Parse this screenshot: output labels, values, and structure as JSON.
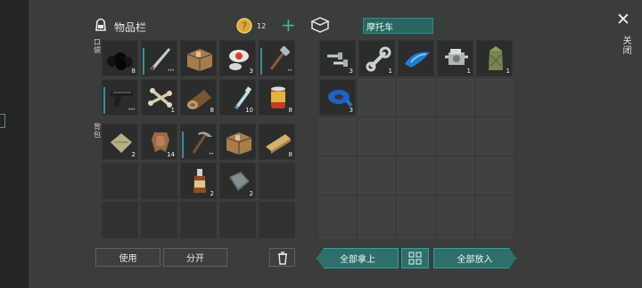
{
  "window": {
    "inventory_title": "物品栏",
    "coins": "12",
    "plus": "+",
    "vehicle_title": "摩托车",
    "close_label": "关闭",
    "pocket_label": "口袋",
    "backpack_label": "背包"
  },
  "inventory": {
    "row1": [
      {
        "label": "coal",
        "count": "8"
      },
      {
        "label": "machete",
        "count": ""
      },
      {
        "label": "box",
        "count": ""
      },
      {
        "label": "bandage",
        "count": "3"
      },
      {
        "label": "hammer",
        "count": ""
      }
    ],
    "row2": [
      {
        "label": "pistol",
        "count": ""
      },
      {
        "label": "bones",
        "count": "1"
      },
      {
        "label": "log",
        "count": "8"
      },
      {
        "label": "water-bottle",
        "count": "10"
      },
      {
        "label": "canned-food",
        "count": "8"
      }
    ],
    "row3": [
      {
        "label": "sack",
        "count": "2"
      },
      {
        "label": "leather",
        "count": "14"
      },
      {
        "label": "pickaxe",
        "count": ""
      },
      {
        "label": "box",
        "count": ""
      },
      {
        "label": "wood-plank",
        "count": "8"
      }
    ],
    "row4": [
      {
        "label": "empty",
        "count": ""
      },
      {
        "label": "empty",
        "count": ""
      },
      {
        "label": "whiskey",
        "count": "2"
      },
      {
        "label": "metal-plate",
        "count": "2"
      },
      {
        "label": "empty",
        "count": ""
      }
    ]
  },
  "vehicle": {
    "row1": [
      {
        "label": "bolts",
        "count": "3"
      },
      {
        "label": "wrench",
        "count": "1"
      },
      {
        "label": "gas-tank",
        "count": ""
      },
      {
        "label": "engine",
        "count": "1"
      },
      {
        "label": "fuel-can",
        "count": "1"
      }
    ],
    "row2": [
      {
        "label": "tape",
        "count": "3"
      }
    ]
  },
  "buttons": {
    "use": "使用",
    "split": "分开",
    "take_all": "全部拿上",
    "put_all": "全部放入"
  },
  "colors": {
    "teal": "#2e6f6b",
    "teal_border": "#2fa49c",
    "panel": "#3b3d3b"
  }
}
